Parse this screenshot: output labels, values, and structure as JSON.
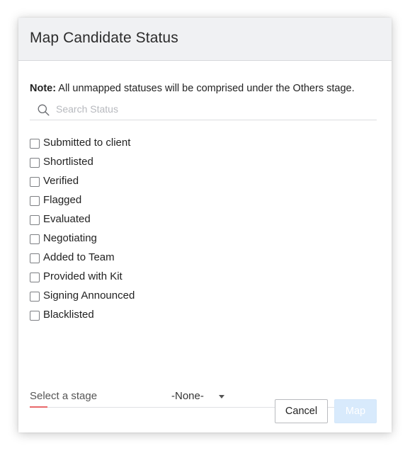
{
  "dialog": {
    "title": "Map Candidate Status",
    "note_label": "Note:",
    "note_text": " All unmapped statuses will be comprised under the Others stage."
  },
  "search": {
    "placeholder": "Search Status",
    "value": "",
    "icon": "search-icon"
  },
  "statuses": [
    {
      "label": "Submitted to client",
      "checked": false
    },
    {
      "label": "Shortlisted",
      "checked": false
    },
    {
      "label": "Verified",
      "checked": false
    },
    {
      "label": "Flagged",
      "checked": false
    },
    {
      "label": "Evaluated",
      "checked": false
    },
    {
      "label": "Negotiating",
      "checked": false
    },
    {
      "label": "Added to Team",
      "checked": false
    },
    {
      "label": "Provided with Kit",
      "checked": false
    },
    {
      "label": "Signing Announced",
      "checked": false
    },
    {
      "label": "Blacklisted",
      "checked": false
    }
  ],
  "stage": {
    "label": "Select a stage",
    "selected": "-None-"
  },
  "footer": {
    "cancel_label": "Cancel",
    "map_label": "Map"
  },
  "colors": {
    "header_bg": "#f0f1f3",
    "required_accent": "#e8686a",
    "primary_disabled": "#d8eafc"
  }
}
